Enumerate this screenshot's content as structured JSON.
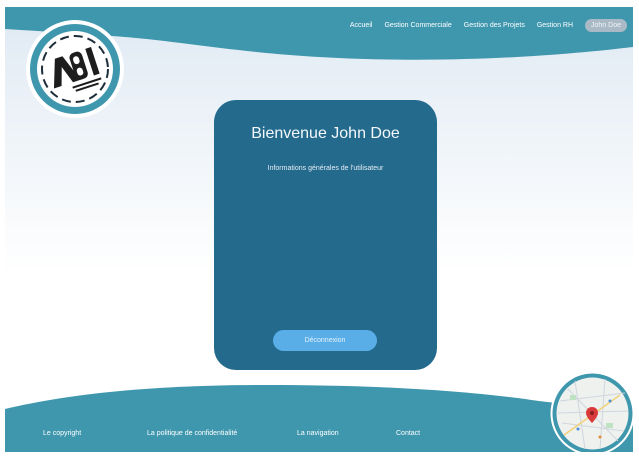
{
  "header": {
    "nav": [
      {
        "label": "Accueil"
      },
      {
        "label": "Gestion Commerciale"
      },
      {
        "label": "Gestion des Projets"
      },
      {
        "label": "Gestion RH"
      }
    ],
    "user_button": "John Doe"
  },
  "logo": {
    "text": "ABI"
  },
  "card": {
    "title": "Bienvenue John Doe",
    "subtitle": "Informations générales de l'utilisateur",
    "logout_label": "Déconnexion"
  },
  "footer": {
    "links": [
      {
        "label": "Le copyright"
      },
      {
        "label": "La politique de confidentialité"
      },
      {
        "label": "La navigation"
      },
      {
        "label": "Contact"
      }
    ]
  },
  "colors": {
    "accent": "#3f97ae",
    "card": "#236a8d",
    "button": "#5aaee8"
  }
}
